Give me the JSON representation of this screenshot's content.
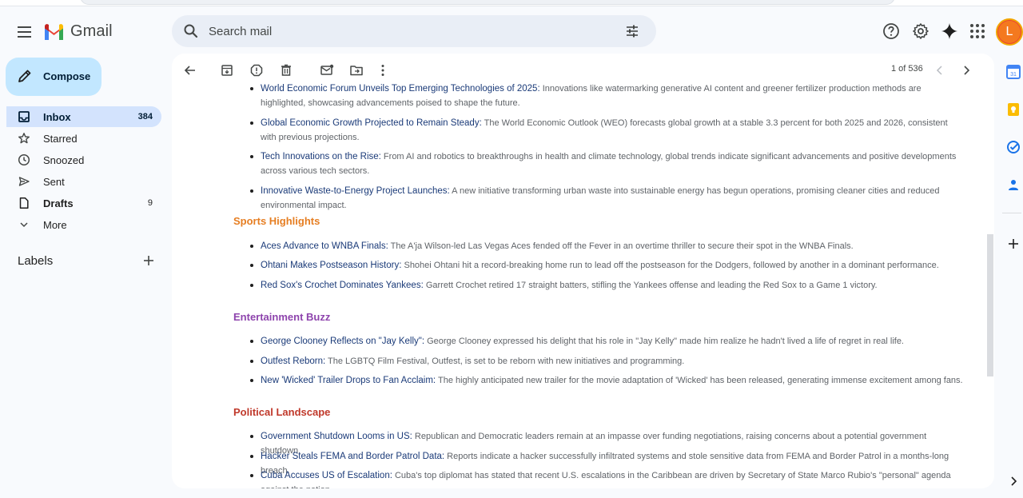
{
  "header": {
    "app_name": "Gmail",
    "search_placeholder": "Search mail"
  },
  "avatar": {
    "initial": "L",
    "color": "#f4791f"
  },
  "compose": {
    "label": "Compose"
  },
  "nav": [
    {
      "label": "Inbox",
      "count": "384",
      "icon": "inbox-icon"
    },
    {
      "label": "Starred",
      "count": "",
      "icon": "star-icon"
    },
    {
      "label": "Snoozed",
      "count": "",
      "icon": "clock-icon"
    },
    {
      "label": "Sent",
      "count": "",
      "icon": "send-icon"
    },
    {
      "label": "Drafts",
      "count": "9",
      "icon": "draft-icon"
    },
    {
      "label": "More",
      "count": "",
      "icon": "chevron-down-icon"
    }
  ],
  "labels": {
    "title": "Labels"
  },
  "toolbar": {
    "pager": "1 of 536"
  },
  "email": {
    "top_items": [
      {
        "title": "World Economic Forum Unveils Top Emerging Technologies of 2025:",
        "desc": " Innovations like watermarking generative AI content and greener fertilizer production methods are highlighted, showcasing advancements poised to shape the future."
      },
      {
        "title": "Global Economic Growth Projected to Remain Steady:",
        "desc": " The World Economic Outlook (WEO) forecasts global growth at a stable 3.3 percent for both 2025 and 2026, consistent with previous projections."
      },
      {
        "title": "Tech Innovations on the Rise:",
        "desc": " From AI and robotics to breakthroughs in health and climate technology, global trends indicate significant advancements and positive developments across various tech sectors."
      },
      {
        "title": "Innovative Waste-to-Energy Project Launches:",
        "desc": " A new initiative transforming urban waste into sustainable energy has begun operations, promising cleaner cities and reduced environmental impact."
      }
    ],
    "sports": {
      "heading": "Sports Highlights",
      "color": "#e67e22",
      "items": [
        {
          "title": "Aces Advance to WNBA Finals:",
          "desc": " The A'ja Wilson-led Las Vegas Aces fended off the Fever in an overtime thriller to secure their spot in the WNBA Finals."
        },
        {
          "title": "Ohtani Makes Postseason History:",
          "desc": " Shohei Ohtani hit a record-breaking home run to lead off the postseason for the Dodgers, followed by another in a dominant performance."
        },
        {
          "title": "Red Sox's Crochet Dominates Yankees:",
          "desc": " Garrett Crochet retired 17 straight batters, stifling the Yankees offense and leading the Red Sox to a Game 1 victory."
        }
      ]
    },
    "entertainment": {
      "heading": "Entertainment Buzz",
      "color": "#8e44ad",
      "items": [
        {
          "title": "George Clooney Reflects on \"Jay Kelly\":",
          "desc": " George Clooney expressed his delight that his role in \"Jay Kelly\" made him realize he hadn't lived a life of regret in real life."
        },
        {
          "title": "Outfest Reborn:",
          "desc": " The LGBTQ Film Festival, Outfest, is set to be reborn with new initiatives and programming."
        },
        {
          "title": "New 'Wicked' Trailer Drops to Fan Acclaim:",
          "desc": " The highly anticipated new trailer for the movie adaptation of 'Wicked' has been released, generating immense excitement among fans."
        }
      ]
    },
    "politics": {
      "heading": "Political Landscape",
      "color": "#c0392b",
      "items": [
        {
          "title": "Government Shutdown Looms in US:",
          "desc": " Republican and Democratic leaders remain at an impasse over funding negotiations, raising concerns about a potential government shutdown."
        },
        {
          "title": "Hacker Steals FEMA and Border Patrol Data:",
          "desc": " Reports indicate a hacker successfully infiltrated systems and stole sensitive data from FEMA and Border Patrol in a months-long breach."
        },
        {
          "title": "Cuba Accuses US of Escalation:",
          "desc": " Cuba's top diplomat has stated that recent U.S. escalations in the Caribbean are driven by Secretary of State Marco Rubio's \"personal\" agenda against the nation."
        }
      ]
    }
  }
}
